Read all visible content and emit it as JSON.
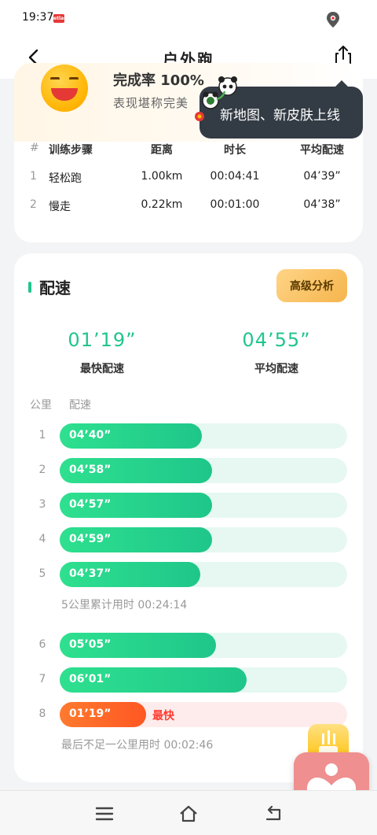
{
  "status_bar": {
    "time": "19:37",
    "badge": "etlas"
  },
  "nav": {
    "title": "户外跑",
    "back_icon": "chevron-left-icon",
    "share_icon": "share-icon"
  },
  "summary": {
    "completion": "完成率 100%",
    "remark": "表现堪称完美"
  },
  "tooltip": {
    "text": "新地图、新皮肤上线"
  },
  "steps": {
    "headers": [
      "#",
      "训练步骤",
      "距离",
      "时长",
      "平均配速"
    ],
    "rows": [
      {
        "no": "1",
        "name": "轻松跑",
        "distance": "1.00km",
        "duration": "00:04:41",
        "pace": "04’39”"
      },
      {
        "no": "2",
        "name": "慢走",
        "distance": "0.22km",
        "duration": "00:01:00",
        "pace": "04’38”"
      }
    ]
  },
  "pace_section": {
    "title": "配速",
    "advanced_button": "高级分析",
    "fastest_value": "01’19”",
    "fastest_label": "最快配速",
    "average_value": "04’55”",
    "average_label": "平均配速",
    "col_km": "公里",
    "col_pace": "配速",
    "km_rows": [
      {
        "km": "1",
        "pace": "04’40”",
        "fill": 0.495
      },
      {
        "km": "2",
        "pace": "04’58”",
        "fill": 0.53
      },
      {
        "km": "3",
        "pace": "04’57”",
        "fill": 0.53
      },
      {
        "km": "4",
        "pace": "04’59”",
        "fill": 0.53
      },
      {
        "km": "5",
        "pace": "04’37”",
        "fill": 0.49
      },
      {
        "km": "6",
        "pace": "05’05”",
        "fill": 0.545
      },
      {
        "km": "7",
        "pace": "06’01”",
        "fill": 0.65
      },
      {
        "km": "8",
        "pace": "01’19”",
        "fill": 0.3,
        "fastest": true
      }
    ],
    "fastest_tag": "最快",
    "cumulative_5km": "5公里累计用时 00:24:14",
    "last_partial": "最后不足一公里用时 00:02:46"
  },
  "bottom_nav": {
    "menu_icon": "menu-icon",
    "home_icon": "home-icon",
    "back_icon": "back-icon"
  },
  "colors": {
    "accent": "#21c58c",
    "fast": "#ff5722",
    "gold": "#f5b54c"
  }
}
